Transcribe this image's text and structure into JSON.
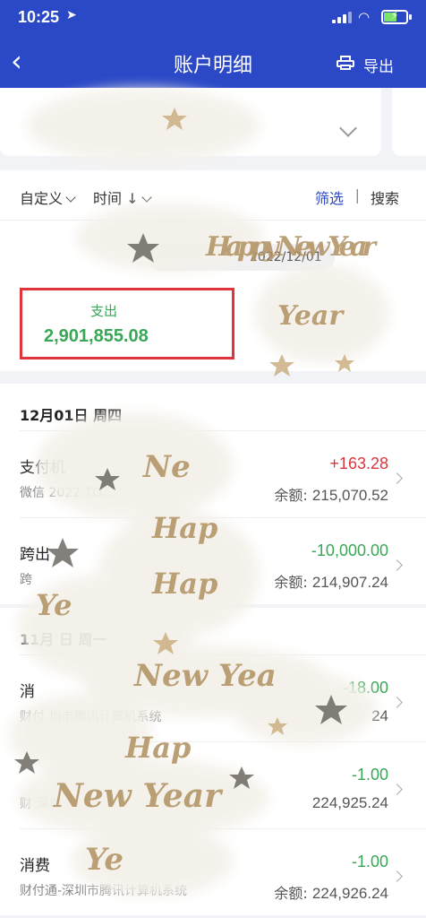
{
  "status_bar": {
    "time": "10:25",
    "location_icon": "location-arrow-icon",
    "signal_icon": "cellular-signal-icon",
    "wifi_icon": "wifi-icon",
    "battery_icon": "battery-charging-icon"
  },
  "nav": {
    "back_icon": "chevron-left-icon",
    "title": "账户明细",
    "export_icon": "printer-icon",
    "export_label": "导出"
  },
  "filters": {
    "custom_label": "自定义",
    "time_label": "时间",
    "time_sort_glyph": "↓",
    "filter_label": "筛选",
    "separator": "|",
    "search_label": "搜索"
  },
  "summary": {
    "date_range_visible": "2022/12/01",
    "expense_label": "支出",
    "expense_amount": "2,901,855.08"
  },
  "balance_label": "余额:",
  "groups": [
    {
      "date_label": "12月01日  周四",
      "transactions": [
        {
          "name": "支付机",
          "desc": "微信 2022 TO...",
          "amount": "+163.28",
          "balance": "215,070.52",
          "direction": "in"
        },
        {
          "name": "跨出",
          "desc": "跨",
          "amount": "-10,000.00",
          "balance": "214,907.24",
          "direction": "out"
        }
      ]
    },
    {
      "date_label": "11月  日  周一",
      "transactions": [
        {
          "name": "消",
          "desc": "财付 圳市腾讯计算机系统",
          "amount": "-18.00",
          "balance": "24",
          "direction": "out"
        },
        {
          "name": "",
          "desc": "财 深圳",
          "amount": "-1.00",
          "balance": "224,925.24",
          "direction": "out"
        },
        {
          "name": "消费",
          "desc": "财付通-深圳市腾讯计算机系统",
          "amount": "-1.00",
          "balance": "224,926.24",
          "direction": "out"
        }
      ]
    }
  ],
  "overlay_text": "Happy New Year",
  "colors": {
    "nav_blue": "#2b48c6",
    "income_red": "#e0343d",
    "expense_green": "#3aa657",
    "highlight_red": "#e0343d"
  }
}
